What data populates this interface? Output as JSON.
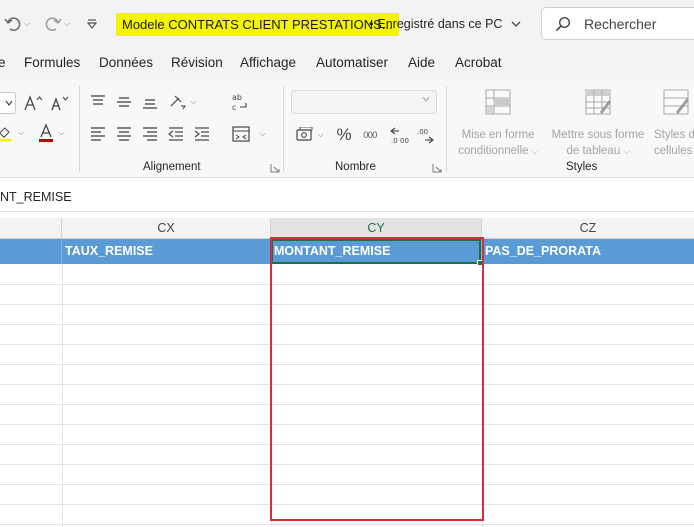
{
  "titlebar": {
    "doc_title": "Modele CONTRATS CLIENT   PRESTATIONS...",
    "save_status": "Enregistré dans ce PC",
    "search_placeholder": "Rechercher",
    "colors": {
      "title_highlight": "#f5f500"
    }
  },
  "menu": {
    "tabs": [
      "e",
      "Formules",
      "Données",
      "Révision",
      "Affichage",
      "Automatiser",
      "Aide",
      "Acrobat"
    ]
  },
  "ribbon": {
    "groups": {
      "alignment": "Alignement",
      "number": "Nombre",
      "styles": "Styles"
    },
    "number_format_value": "",
    "percent_symbol": "%",
    "thousands_label": "000",
    "styles_buttons": {
      "conditional": [
        "Mise en forme",
        "conditionnelle"
      ],
      "table": [
        "Mettre sous forme",
        "de tableau"
      ],
      "cell": [
        "Styles de",
        "cellules"
      ]
    }
  },
  "formula_bar": {
    "name_box": "NT_REMISE"
  },
  "grid": {
    "columns": [
      "CX",
      "CY",
      "CZ"
    ],
    "active_column": "CY",
    "header_row": [
      "TAUX_REMISE",
      "MONTANT_REMISE",
      "PAS_DE_PRORATA"
    ],
    "colors": {
      "header_fill": "#5b9bd5",
      "selection": "#1e7145",
      "highlight_box": "#d32f3a"
    }
  }
}
